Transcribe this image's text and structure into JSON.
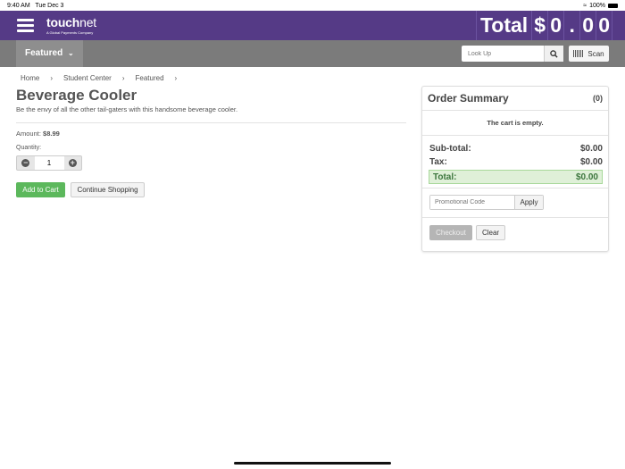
{
  "status": {
    "time": "9:40 AM",
    "date": "Tue Dec 3",
    "battery": "100%"
  },
  "header": {
    "brand": "touch",
    "brand2": "net",
    "tagline": "A Global Payments Company",
    "total_label": "Total",
    "total_chars": [
      "$",
      "0",
      ".",
      "0",
      "0"
    ]
  },
  "nav": {
    "featured": "Featured",
    "lookup_placeholder": "Look Up",
    "scan": "Scan"
  },
  "breadcrumb": [
    "Home",
    "Student Center",
    "Featured"
  ],
  "product": {
    "title": "Beverage Cooler",
    "description": "Be the envy of all the other tail-gaters with this handsome beverage cooler.",
    "amount_label": "Amount:",
    "amount": "$8.99",
    "quantity_label": "Quantity:",
    "quantity": "1",
    "add_to_cart": "Add to Cart",
    "continue": "Continue Shopping"
  },
  "summary": {
    "title": "Order Summary",
    "count": "(0)",
    "empty": "The cart is empty.",
    "subtotal_label": "Sub-total:",
    "subtotal": "$0.00",
    "tax_label": "Tax:",
    "tax": "$0.00",
    "total_label": "Total:",
    "total": "$0.00",
    "promo_placeholder": "Promotional Code",
    "apply": "Apply",
    "checkout": "Checkout",
    "clear": "Clear"
  }
}
